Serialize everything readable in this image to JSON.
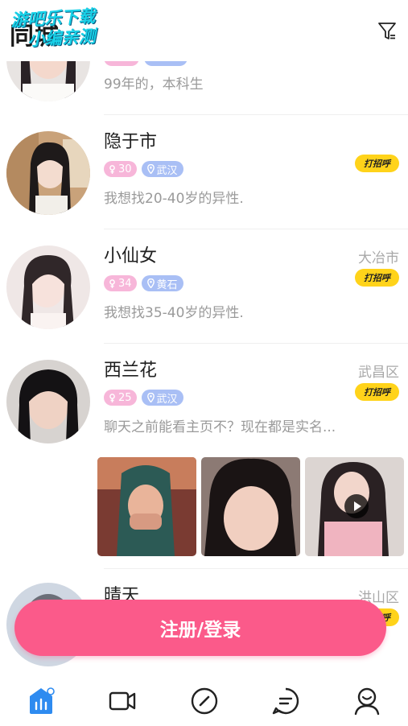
{
  "header": {
    "title": "同城",
    "filter_icon": "filter-icon"
  },
  "watermark": {
    "line1": "游吧乐下载",
    "line2": "小编亲测"
  },
  "users": [
    {
      "desc": "99年的，本科生"
    },
    {
      "name": "隐于市",
      "age": "30",
      "location": "武汉",
      "desc": "我想找20-40岁的异性.",
      "greet": "打招呼"
    },
    {
      "name": "小仙女",
      "age": "34",
      "location": "黄石",
      "desc": "我想找35-40岁的异性.",
      "district": "大冶市",
      "greet": "打招呼"
    },
    {
      "name": "西兰花",
      "age": "25",
      "location": "武汉",
      "desc": "聊天之前能看主页不？现在都是实名...",
      "district": "武昌区",
      "greet": "打招呼"
    },
    {
      "name": "晴天",
      "district": "洪山区",
      "greet": "打招呼"
    }
  ],
  "login_button": "注册/登录",
  "tabs": [
    "home-icon",
    "video-icon",
    "discover-icon",
    "messages-icon",
    "profile-icon"
  ],
  "colors": {
    "accent": "#fb5a8a",
    "greet": "#ffd31a",
    "age_tag": "#f7b6d9",
    "location_tag": "#a9bff5",
    "tab_active": "#2e8bf0"
  }
}
